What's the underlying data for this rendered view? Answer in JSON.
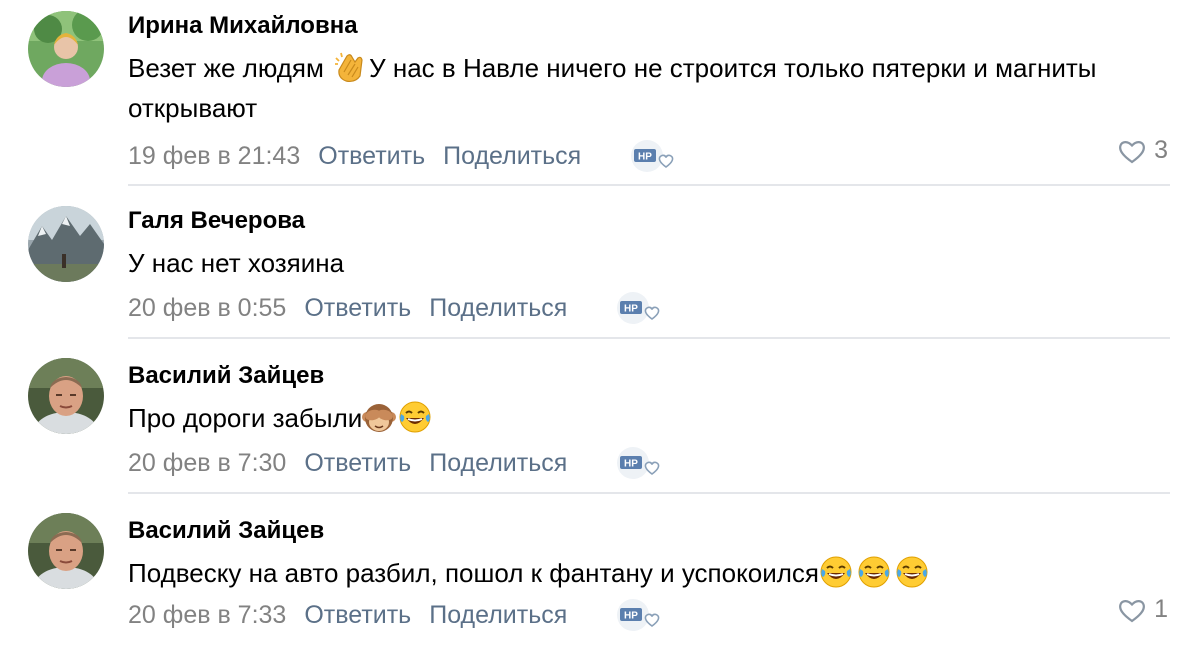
{
  "comments": [
    {
      "author": "Ирина Михайловна",
      "text": "Везет же людям ",
      "emoji_inline": "clapping-hands",
      "text_after": "У нас в Навле ничего не строится только пятерки и магниты открывают",
      "date": "19 фев в 21:43",
      "reply_label": "Ответить",
      "share_label": "Поделиться",
      "likes": "3"
    },
    {
      "author": "Галя Вечерова",
      "text": "У нас нет хозяина",
      "date": "20 фев в 0:55",
      "reply_label": "Ответить",
      "share_label": "Поделиться"
    },
    {
      "author": "Василий Зайцев",
      "text": "Про дороги забыли",
      "emojis": [
        "see-no-evil-monkey",
        "tears-of-joy"
      ],
      "date": "20 фев в 7:30",
      "reply_label": "Ответить",
      "share_label": "Поделиться"
    },
    {
      "author": "Василий Зайцев",
      "text": "Подвеску на авто разбил, пошол к фантану и успокоился",
      "emojis": [
        "tears-of-joy",
        "tears-of-joy",
        "tears-of-joy"
      ],
      "date": "20 фев в 7:33",
      "reply_label": "Ответить",
      "share_label": "Поделиться",
      "likes": "1"
    }
  ],
  "icons": {
    "like": "heart-outline-icon",
    "badge": "nr-badge-heart-icon"
  },
  "colors": {
    "link": "#5b7088",
    "meta": "#828282",
    "divider": "#e4e6ea"
  }
}
